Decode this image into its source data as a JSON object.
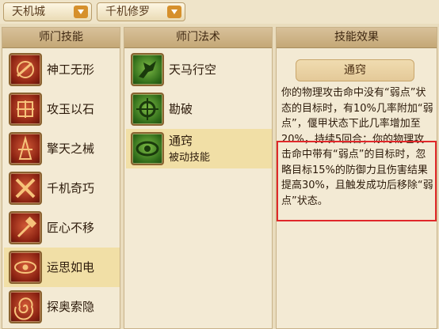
{
  "toolbar": {
    "dropdown1": "天机城",
    "dropdown2": "千机修罗"
  },
  "panels": {
    "skills_header": "师门技能",
    "arts_header": "师门法术",
    "effect_header": "技能效果"
  },
  "skills": [
    {
      "label": "神工无形",
      "icon": "mechanism-orb-icon"
    },
    {
      "label": "攻玉以石",
      "icon": "jade-stone-icon"
    },
    {
      "label": "擎天之械",
      "icon": "pillar-mechanism-icon"
    },
    {
      "label": "千机奇巧",
      "icon": "cross-blades-icon"
    },
    {
      "label": "匠心不移",
      "icon": "hammer-icon"
    },
    {
      "label": "运思如电",
      "icon": "eye-lightning-icon",
      "selected": true
    },
    {
      "label": "探奥索隐",
      "icon": "swirl-icon"
    }
  ],
  "arts": [
    {
      "label": "天马行空",
      "icon": "pegasus-icon"
    },
    {
      "label": "勘破",
      "icon": "crosshair-icon"
    },
    {
      "label": "通窍",
      "sub": "被动技能",
      "icon": "eye-icon",
      "selected": true
    }
  ],
  "effect": {
    "title": "通窍",
    "text": "你的物理攻击命中没有“弱点”状态的目标时，有10%几率附加“弱点”，偃甲状态下此几率增加至20%，持续5回合；你的物理攻击命中带有“弱点”的目标时，忽略目标15%的防御力且伤害结果提高30%，且触发成功后移除“弱点”状态。"
  },
  "colors": {
    "selected_row": "#f1dfa6",
    "highlight_border": "#e0282a",
    "panel_header": "#c4a876"
  }
}
